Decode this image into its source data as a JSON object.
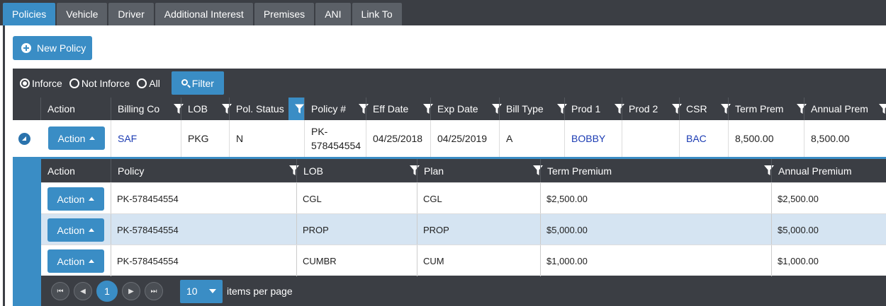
{
  "tabs": [
    "Policies",
    "Vehicle",
    "Driver",
    "Additional Interest",
    "Premises",
    "ANI",
    "Link To"
  ],
  "active_tab": "Policies",
  "new_policy_label": "New Policy",
  "filter_bar": {
    "radios": [
      {
        "label": "Inforce",
        "checked": true
      },
      {
        "label": "Not Inforce",
        "checked": false
      },
      {
        "label": "All",
        "checked": false
      }
    ],
    "filter_button": "Filter"
  },
  "grid": {
    "columns": [
      "Action",
      "Billing Co",
      "LOB",
      "Pol. Status",
      "Policy #",
      "Eff Date",
      "Exp Date",
      "Bill Type",
      "Prod 1",
      "Prod 2",
      "CSR",
      "Term Prem",
      "Annual Prem"
    ],
    "active_filter_column": "Pol. Status",
    "row": {
      "action": "Action",
      "billing_co": "SAF",
      "lob": "PKG",
      "pol_status": "N",
      "policy_line1": "PK-",
      "policy_line2": "578454554",
      "eff_date": "04/25/2018",
      "exp_date": "04/25/2019",
      "bill_type": "A",
      "prod1": "BOBBY",
      "prod2": "",
      "csr": "BAC",
      "term_prem": "8,500.00",
      "annual_prem": "8,500.00"
    }
  },
  "detail": {
    "columns": [
      "Action",
      "Policy",
      "LOB",
      "Plan",
      "Term Premium",
      "Annual Premium"
    ],
    "rows": [
      {
        "action": "Action",
        "policy": "PK-578454554",
        "lob": "CGL",
        "plan": "CGL",
        "term": "$2,500.00",
        "annual": "$2,500.00"
      },
      {
        "action": "Action",
        "policy": "PK-578454554",
        "lob": "PROP",
        "plan": "PROP",
        "term": "$5,000.00",
        "annual": "$5,000.00"
      },
      {
        "action": "Action",
        "policy": "PK-578454554",
        "lob": "CUMBR",
        "plan": "CUM",
        "term": "$1,000.00",
        "annual": "$1,000.00"
      }
    ],
    "pager": {
      "current_page": "1",
      "page_size": "10",
      "items_per_page_label": "items per page"
    }
  },
  "colors": {
    "accent": "#3a8dc5",
    "header": "#3b3e44",
    "row_alt": "#d5e4f2",
    "link": "#1b3bb3"
  }
}
